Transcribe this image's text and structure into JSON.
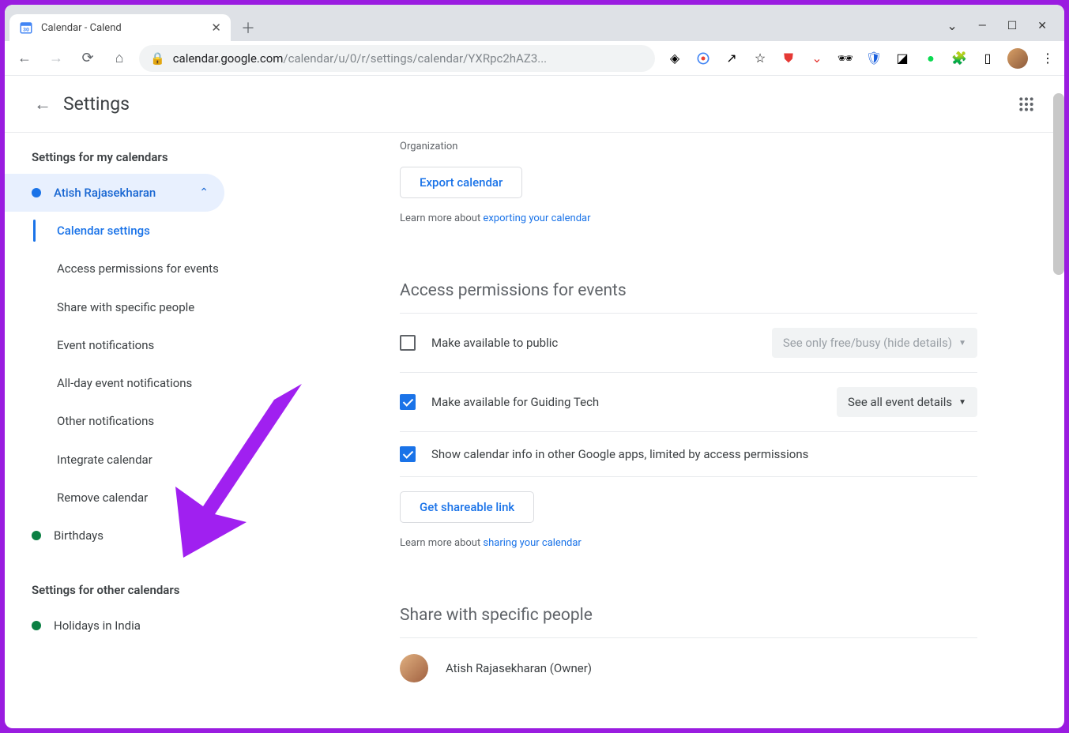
{
  "browser": {
    "tab_title": "Calendar - Calend",
    "url_host": "calendar.google.com",
    "url_path": "/calendar/u/0/r/settings/calendar/YXRpc2hAZ3...",
    "window_min": "—",
    "window_max": "☐",
    "window_close": "✕"
  },
  "header": {
    "title": "Settings"
  },
  "sidebar": {
    "section1": "Settings for my calendars",
    "cal1": {
      "label": "Atish Rajasekharan",
      "color": "#1a73e8"
    },
    "sub": {
      "s0": "Calendar settings",
      "s1": "Access permissions for events",
      "s2": "Share with specific people",
      "s3": "Event notifications",
      "s4": "All-day event notifications",
      "s5": "Other notifications",
      "s6": "Integrate calendar",
      "s7": "Remove calendar"
    },
    "cal2": {
      "label": "Birthdays",
      "color": "#0b8043"
    },
    "section2": "Settings for other calendars",
    "cal3": {
      "label": "Holidays in India",
      "color": "#0b8043"
    }
  },
  "main": {
    "org_label": "Organization",
    "export_btn": "Export calendar",
    "learn_export_prefix": "Learn more about ",
    "learn_export_link": "exporting your calendar",
    "access_title": "Access permissions for events",
    "perm1": "Make available to public",
    "perm1_dd": "See only free/busy (hide details)",
    "perm2": "Make available for Guiding Tech",
    "perm2_dd": "See all event details",
    "perm3": "Show calendar info in other Google apps, limited by access permissions",
    "get_link_btn": "Get shareable link",
    "learn_share_prefix": "Learn more about ",
    "learn_share_link": "sharing your calendar",
    "share_title": "Share with specific people",
    "share_person": "Atish Rajasekharan (Owner)"
  }
}
